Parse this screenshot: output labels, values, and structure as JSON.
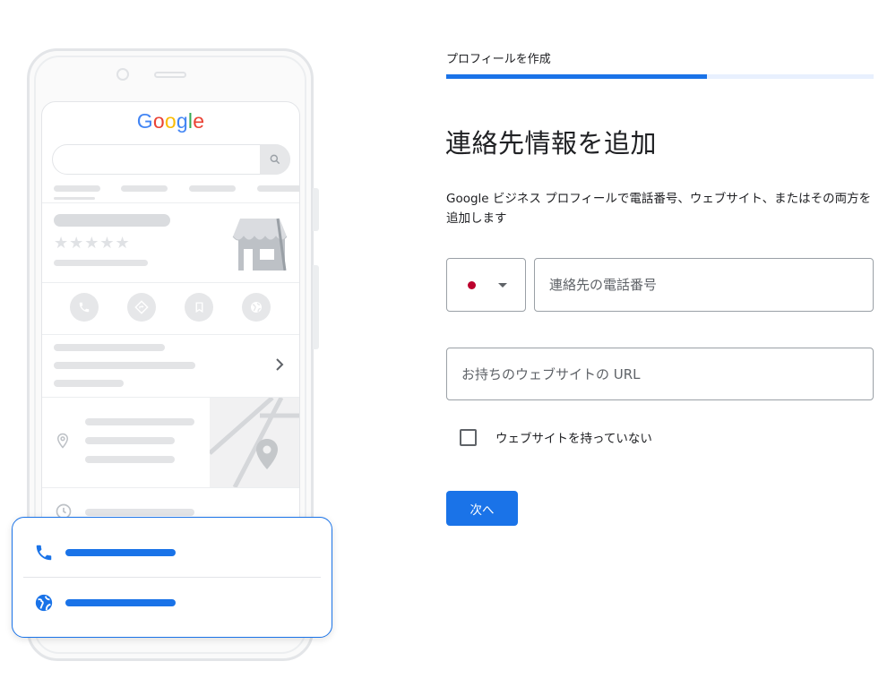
{
  "colors": {
    "accent": "#1a73e8",
    "progress_track": "#e8f0fe",
    "flag_red": "#bc002d",
    "google_blue": "#4285F4",
    "google_red": "#EA4335",
    "google_yellow": "#FBBC05",
    "google_green": "#34A853"
  },
  "illustration": {
    "logo_letters": [
      "G",
      "o",
      "o",
      "g",
      "l",
      "e"
    ],
    "stars": "★★★★★",
    "icons": [
      "search-icon",
      "phone-icon",
      "directions-icon",
      "bookmark-icon",
      "globe-icon",
      "chevron-right-icon",
      "location-pin-icon",
      "clock-icon",
      "store-icon",
      "map-pin-icon"
    ]
  },
  "form": {
    "step_label": "プロフィールを作成",
    "progress_fraction": 0.61,
    "title": "連絡先情報を追加",
    "description": "Google ビジネス プロフィールで電話番号、ウェブサイト、またはその両方を追加します",
    "country_select": {
      "icon": "japan-flag-icon",
      "dropdown_icon": "caret-down-icon"
    },
    "phone_placeholder": "連絡先の電話番号",
    "website_placeholder": "お持ちのウェブサイトの URL",
    "no_website_label": "ウェブサイトを持っていない",
    "no_website_checked": false,
    "next_button": "次へ"
  }
}
